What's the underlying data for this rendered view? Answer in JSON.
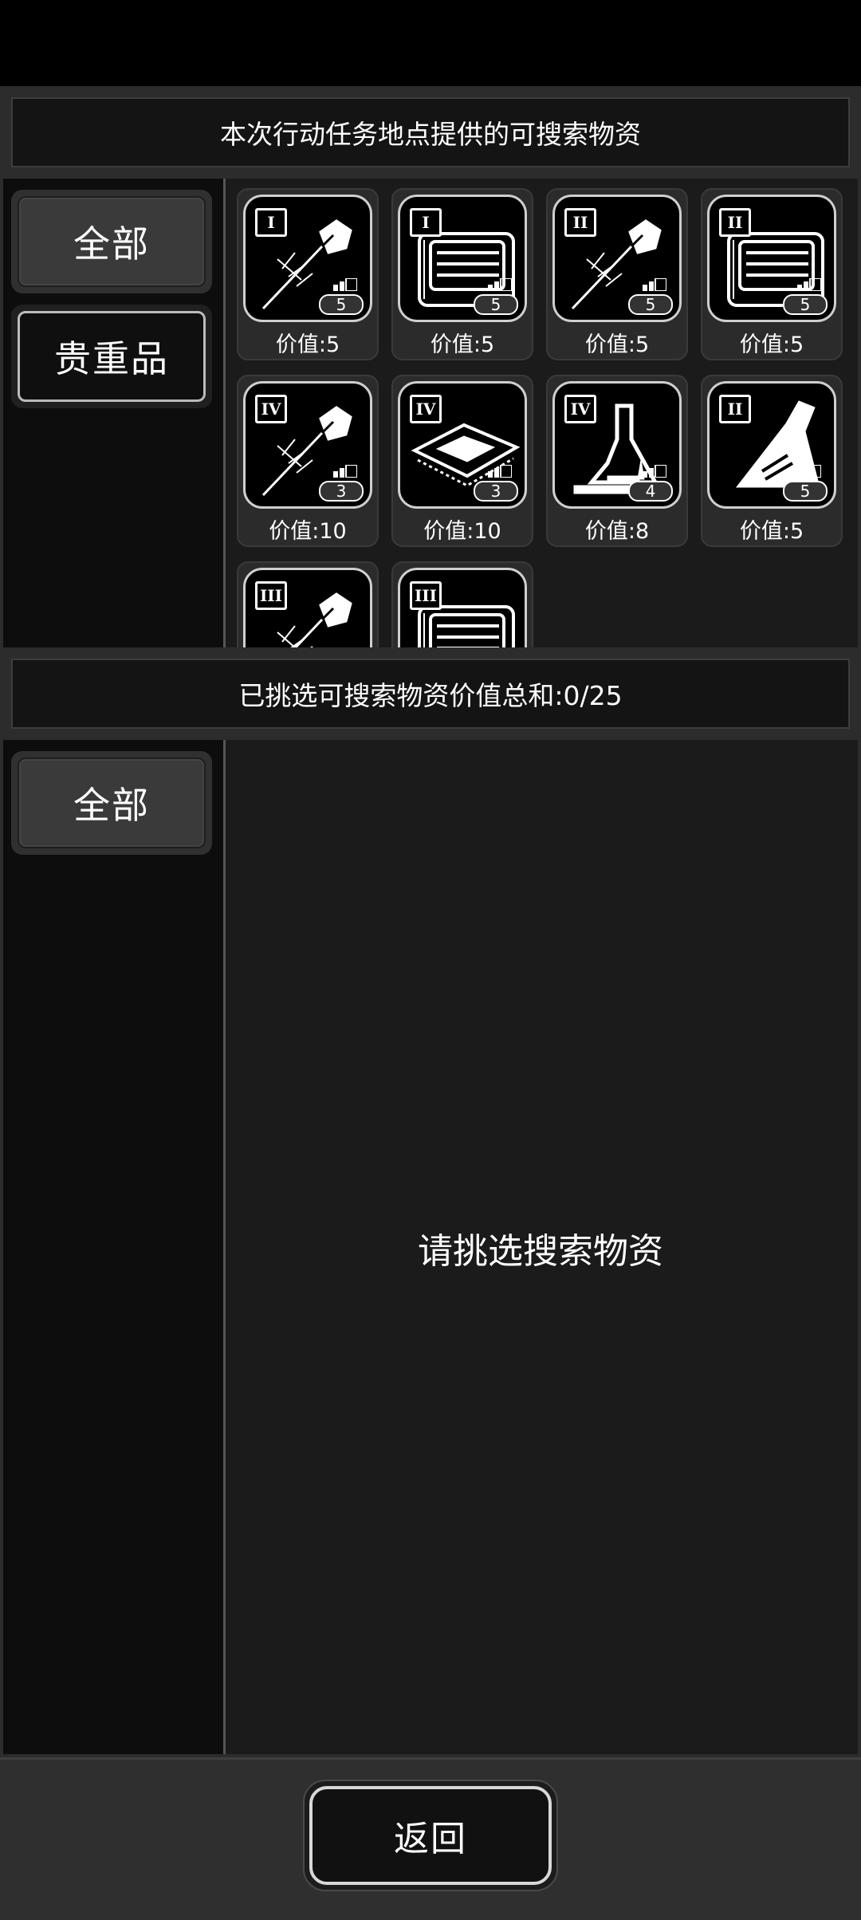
{
  "header": {
    "title": "本次行动任务地点提供的可搜索物资"
  },
  "left_tabs_top": {
    "all": "全部",
    "valuable": "贵重品"
  },
  "items": [
    {
      "tier": "I",
      "icon": "tool-probe-icon",
      "count": "5",
      "value": "价值:5"
    },
    {
      "tier": "I",
      "icon": "machine-icon",
      "count": "5",
      "value": "价值:5"
    },
    {
      "tier": "II",
      "icon": "tool-probe-icon",
      "count": "5",
      "value": "价值:5"
    },
    {
      "tier": "II",
      "icon": "machine-icon",
      "count": "5",
      "value": "价值:5"
    },
    {
      "tier": "IV",
      "icon": "tool-probe-icon",
      "count": "3",
      "value": "价值:10"
    },
    {
      "tier": "IV",
      "icon": "chip-icon",
      "count": "3",
      "value": "价值:10"
    },
    {
      "tier": "IV",
      "icon": "lab-flask-icon",
      "count": "4",
      "value": "价值:8"
    },
    {
      "tier": "II",
      "icon": "conical-flask-icon",
      "count": "5",
      "value": "价值:5"
    },
    {
      "tier": "III",
      "icon": "tool-probe-icon",
      "count": "",
      "value": ""
    },
    {
      "tier": "III",
      "icon": "machine-icon",
      "count": "",
      "value": ""
    }
  ],
  "selection": {
    "title": "已挑选可搜索物资价值总和:0/25",
    "tab_all": "全部",
    "empty_text": "请挑选搜索物资"
  },
  "footer": {
    "back_label": "返回"
  },
  "colors": {
    "background": "#2c2c2c",
    "panel": "#1b1b1b",
    "text": "#ffffff",
    "card_border": "#cfcfcf"
  }
}
